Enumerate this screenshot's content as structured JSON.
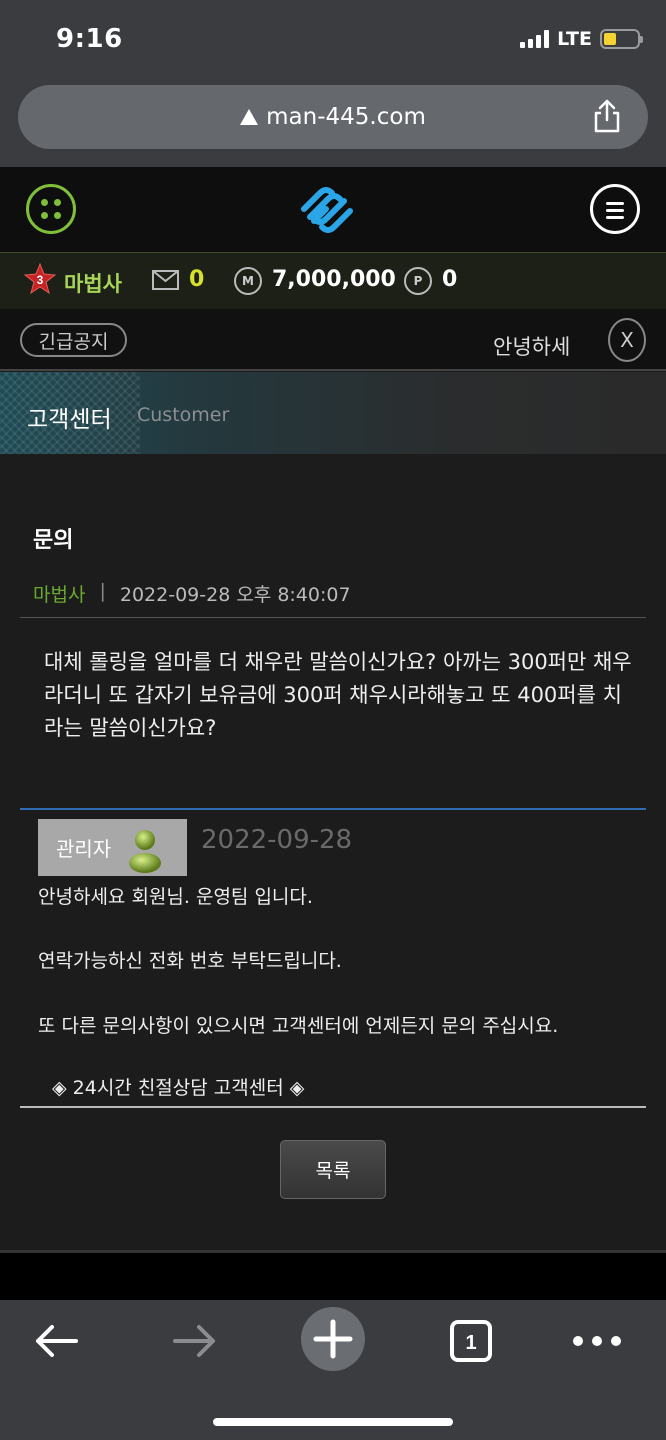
{
  "status_bar": {
    "time": "9:16",
    "network": "LTE"
  },
  "browser": {
    "url": "man-445.com"
  },
  "user": {
    "name": "마법사",
    "level": "3",
    "mail_count": "0",
    "money_icon": "M",
    "money": "7,000,000",
    "point_icon": "P",
    "points": "0"
  },
  "notice": {
    "label": "긴급공지",
    "text": "안녕하세",
    "close": "X"
  },
  "section": {
    "title": "고객센터",
    "subtitle": "Customer"
  },
  "inquiry": {
    "title": "문의",
    "author": "마법사",
    "separator": "|",
    "datetime": "2022-09-28 오후 8:40:07",
    "body": "대체 롤링을 얼마를 더 채우란 말씀이신가요? 아까는 300퍼만 채우라더니 또 갑자기 보유금에 300퍼 채우시라해놓고 또 400퍼를 치라는 말씀이신가요?"
  },
  "answer": {
    "author": "관리자",
    "date": "2022-09-28",
    "lines": [
      "안녕하세요 회원님.  운영팀 입니다.",
      "연락가능하신 전화 번호 부탁드립니다.",
      "또 다른 문의사항이 있으시면 고객센터에 언제든지 문의 주십시요.",
      "◈ 24시간 친절상담 고객센터 ◈"
    ]
  },
  "buttons": {
    "list": "목록"
  },
  "toolbar": {
    "tab_count": "1"
  },
  "colors": {
    "accent_green": "#7fbf3a",
    "author_green": "#6aa82f",
    "answer_border": "#2e6cb5"
  }
}
